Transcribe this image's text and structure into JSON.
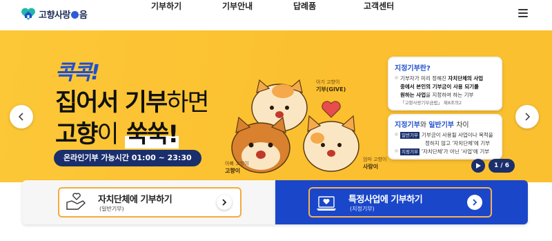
{
  "header": {
    "logo_text_pre": "고향사랑",
    "logo_text_post": "음",
    "nav": [
      "기부하기",
      "기부안내",
      "답례품",
      "고객센터"
    ]
  },
  "hero": {
    "kkok": "콕콕!",
    "line1_bold": "집어서 기부",
    "line1_light": "하면",
    "line2_bold": "고향",
    "line2_light": "이",
    "line2_accent": "쑥쑥!",
    "hours": "온라인기부 가능시간 01:00 ~ 23:30",
    "cat_labels": [
      {
        "small": "아기 고향이",
        "big": "기부(GIVE)"
      },
      {
        "small": "아빠 고향이",
        "big": "고향이"
      },
      {
        "small": "엄마 고향이",
        "big": "사랑이"
      }
    ],
    "card1": {
      "title": "지정기부란?",
      "line1_pre": "기부자가 미리 정해진 ",
      "line1_bold": "자치단체의 사업",
      "line2": "중에서 본인의 기부금이 사용 되기를",
      "line3_bold": "원하는 사업",
      "line3_post": "을 지정하여 하는 기부",
      "line4": "「고향사랑기부금법」 제8조의2"
    },
    "card2": {
      "title_a": "지정기부",
      "title_mid": "와 ",
      "title_b": "일반기부",
      "title_post": " 차이",
      "tag1": "일반기부",
      "row1a": "기부금이 사용될 사업이나 목적을",
      "row1b": "정하지 않고 '자치단체'에 기부",
      "tag2": "지정기부",
      "row2": "'자치단체'가 아닌 '사업'에 기부"
    },
    "counter": "1 / 6"
  },
  "donate": {
    "general_title": "자치단체에 기부하기",
    "general_sub": "(일반기부)",
    "designated_title": "특정사업에 기부하기",
    "designated_sub": "(지정기부)"
  },
  "colors": {
    "brand_blue": "#1a47c9",
    "navy": "#1a2f6b",
    "hero_yellow": "#fcc33a",
    "accent_orange": "#f6a93b"
  }
}
